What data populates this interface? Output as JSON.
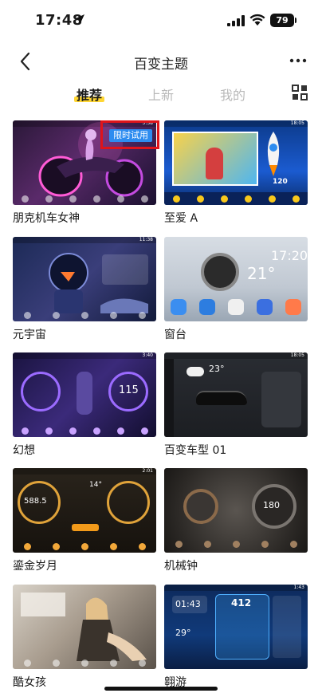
{
  "status_bar": {
    "time": "17:48",
    "battery": "79"
  },
  "header": {
    "title": "百变主题"
  },
  "tabs": [
    {
      "label": "推荐",
      "active": true
    },
    {
      "label": "上新",
      "active": false
    },
    {
      "label": "我的",
      "active": false
    }
  ],
  "trial_badge": "限时试用",
  "themes": [
    {
      "name": "朋克机车女神",
      "screen_time": "5:38"
    },
    {
      "name": "至爱 A",
      "screen_time": "18:05"
    },
    {
      "name": "元宇宙",
      "screen_time": "11:38"
    },
    {
      "name": "窗台",
      "screen_time": "17:20"
    },
    {
      "name": "幻想",
      "screen_time": "3:40"
    },
    {
      "name": "百变车型 01",
      "screen_time": "18:05"
    },
    {
      "name": "鎏金岁月",
      "screen_time": "2:01"
    },
    {
      "name": "机械钟",
      "screen_time": ""
    },
    {
      "name": "酷女孩",
      "screen_time": ""
    },
    {
      "name": "翱游",
      "screen_time": "1:43"
    }
  ],
  "thumb_texts": {
    "fantasy_speed": "115",
    "wheel_temp": "23°",
    "gold_value": "588.5",
    "gold_temp": "14°",
    "clock_value": "180",
    "cruise_time": "01:43",
    "cruise_speed": "412",
    "cruise_temp": "29°",
    "window_temp": "21°",
    "window_time": "17:20",
    "aa_speed": "120"
  }
}
